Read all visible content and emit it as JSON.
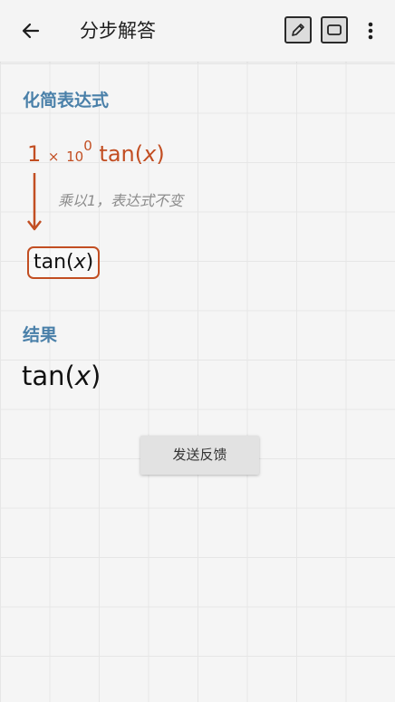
{
  "header": {
    "title": "分步解答",
    "icons": [
      "back-arrow-icon",
      "pencil-icon",
      "square-icon",
      "more-vertical-icon"
    ]
  },
  "simplify": {
    "heading": "化简表达式",
    "expression": {
      "coefficient": "1",
      "times": "×",
      "base": "10",
      "exponent": "0",
      "func": "tan(",
      "var": "x",
      "close": ")"
    },
    "step_note": "乘以1，表达式不变",
    "step_result": {
      "func": "tan(",
      "var": "x",
      "close": ")"
    }
  },
  "result": {
    "heading": "结果",
    "value": {
      "func": "tan(",
      "var": "x",
      "close": ")"
    }
  },
  "feedback_button": "发送反馈",
  "colors": {
    "heading": "#4a80a9",
    "highlight": "#c24e22",
    "note": "#8c8c8c"
  }
}
